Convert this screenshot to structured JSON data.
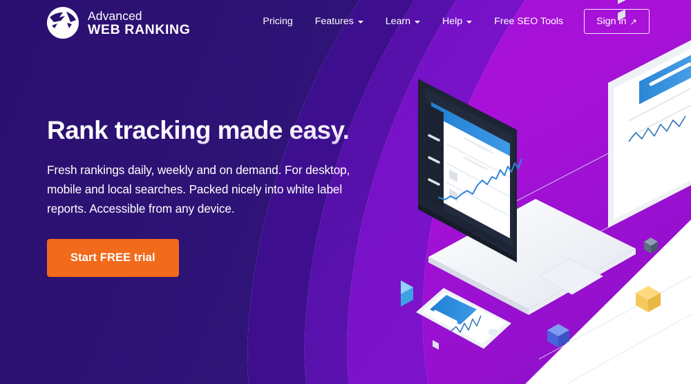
{
  "brand": {
    "logo_icon": "globe-logo-icon",
    "name_line1": "Advanced",
    "name_line2": "WEB RANKING"
  },
  "nav": {
    "items": [
      {
        "label": "Pricing",
        "has_dropdown": false
      },
      {
        "label": "Features",
        "has_dropdown": true
      },
      {
        "label": "Learn",
        "has_dropdown": true
      },
      {
        "label": "Help",
        "has_dropdown": true
      },
      {
        "label": "Free SEO Tools",
        "has_dropdown": false
      }
    ],
    "signin": {
      "label": "Sign in",
      "arrow": "↗"
    }
  },
  "hero": {
    "title": "Rank tracking made easy.",
    "subtitle": "Fresh rankings daily, weekly and on demand. For desktop, mobile and local searches. Packed nicely into white label reports. Accessible from any device.",
    "cta_label": "Start FREE trial"
  },
  "illustration": {
    "devices": [
      "laptop",
      "tablet",
      "smartphone"
    ],
    "accent_cubes": [
      "light-blue-cube-cluster",
      "gold-cube-cluster",
      "royal-blue-cube",
      "slate-cube"
    ],
    "chart_accent": "#2f86d8"
  },
  "colors": {
    "bg_indigo": "#2b1170",
    "bg_purple_mid": "#4e0f9e",
    "bg_purple_bright": "#6a0fc0",
    "bg_magenta": "#a911d8",
    "cta_orange": "#f26a1b",
    "white": "#ffffff",
    "device_blue": "#2f86d8",
    "device_dark": "#1d2433"
  }
}
